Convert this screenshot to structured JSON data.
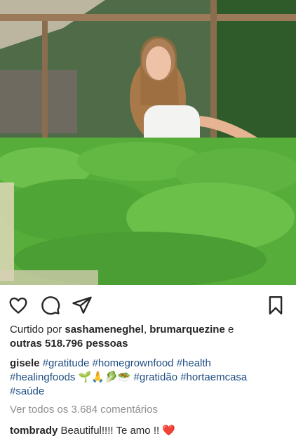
{
  "post": {
    "photo_alt": "",
    "liked_by_prefix": "Curtido por",
    "liker_1": "sashameneghel",
    "liker_sep": ",",
    "liker_2": "brumarquezine",
    "likes_and": "e",
    "likes_count": "outras 518.796 pessoas",
    "caption_user": "gisele",
    "caption_tags_1": [
      "#gratitude",
      "#homegrownfood",
      "#health"
    ],
    "caption_tags_2a": "#healingfoods",
    "caption_emojis": "🌱🙏🥬🥗",
    "caption_tags_2b": [
      "#gratidão",
      "#hortaemcasa"
    ],
    "caption_tags_3": "#saúde",
    "view_all": "Ver todos os 3.684 comentários",
    "comment_user": "tombrady",
    "comment_text": "Beautiful!!!! Te amo !!",
    "comment_heart": "❤️"
  },
  "icons": {
    "like": "heart-outline",
    "comment": "speech-bubble",
    "share": "paper-plane",
    "save": "bookmark"
  }
}
